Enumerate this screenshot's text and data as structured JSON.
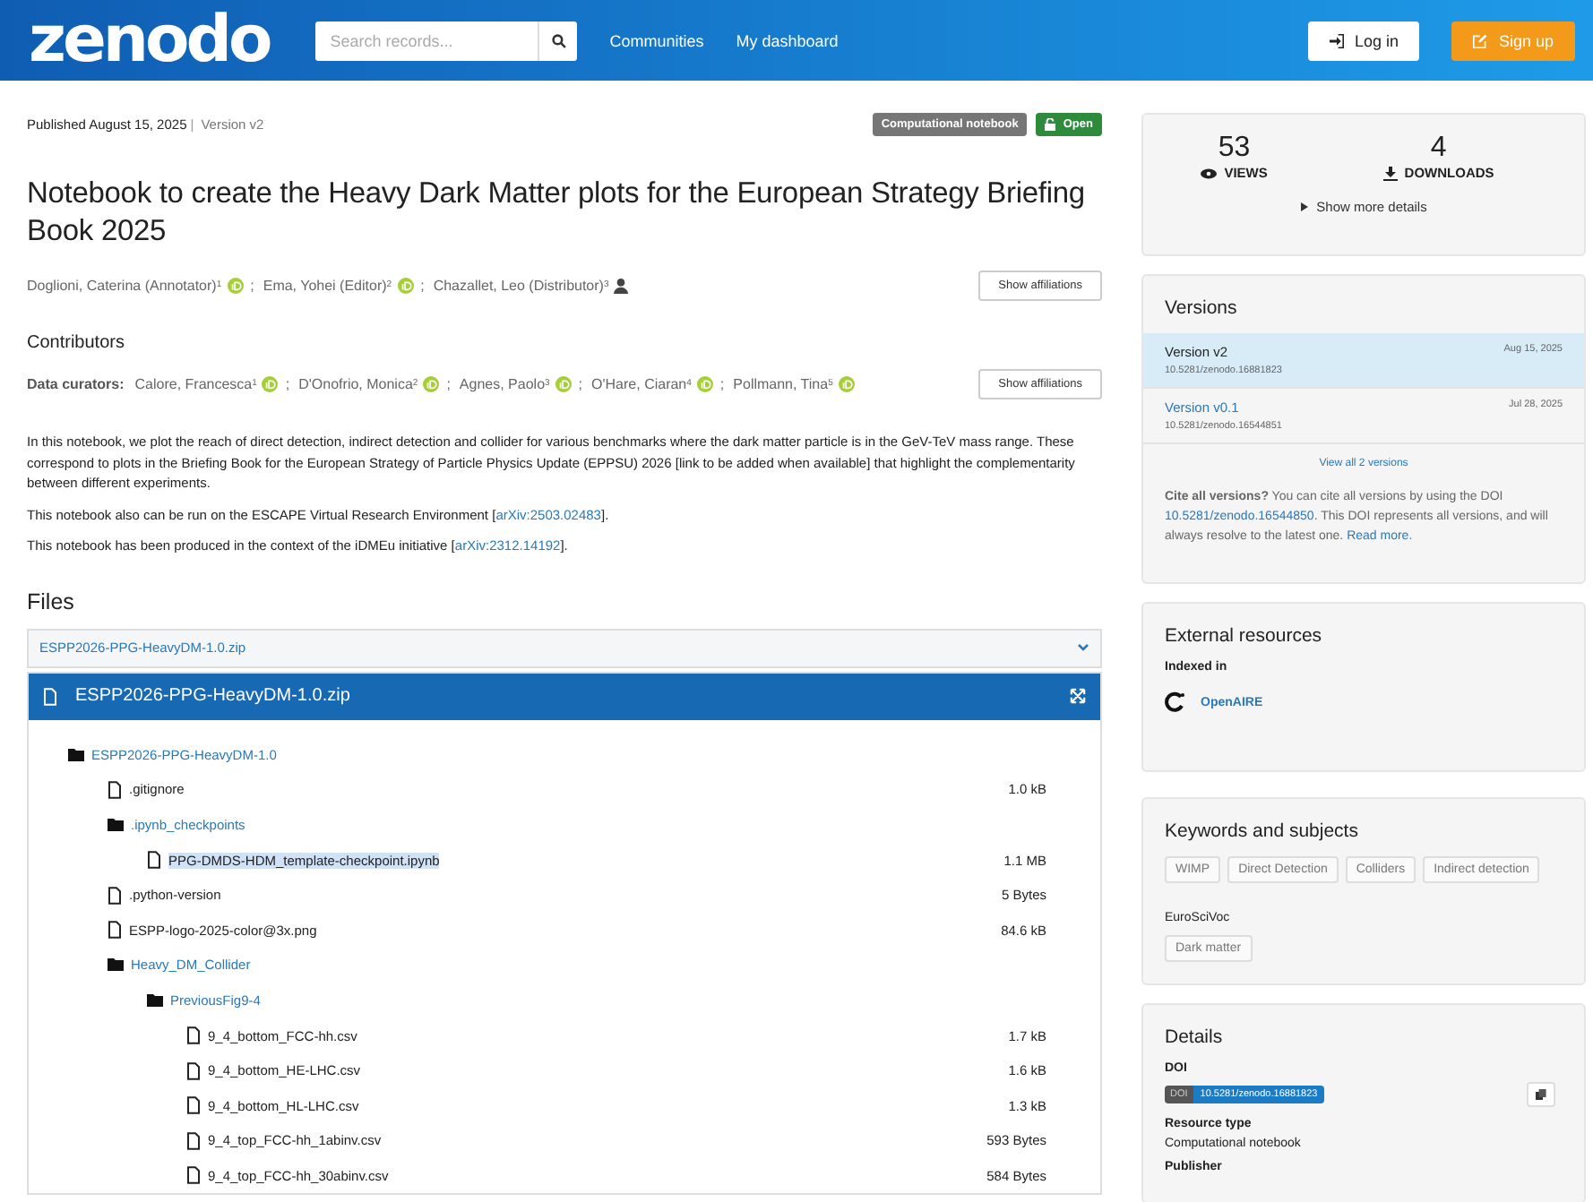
{
  "header": {
    "logo": "zenodo",
    "search": {
      "placeholder": "Search records..."
    },
    "nav": [
      "Communities",
      "My dashboard"
    ],
    "login": "Log in",
    "signup": "Sign up"
  },
  "record": {
    "published": "Published August 15, 2025",
    "divider": "|",
    "version": "Version v2",
    "separator": ";",
    "badges": [
      {
        "kind": "type",
        "label": "Computational notebook"
      },
      {
        "kind": "access",
        "label": "Open"
      }
    ],
    "title": "Notebook to create the Heavy Dark Matter plots for the European Strategy Briefing Book 2025",
    "creators": [
      {
        "name": "Doglioni, Caterina (Annotator)",
        "sup": "1",
        "kind": "orcid"
      },
      {
        "name": "Ema, Yohei (Editor)",
        "sup": "2",
        "kind": "orcid"
      },
      {
        "name": "Chazallet, Leo (Distributor)",
        "sup": "3",
        "kind": "person"
      }
    ],
    "show_affiliations": "Show affiliations",
    "contributors_heading": "Contributors",
    "curators_label": "Data curators:",
    "curators": [
      {
        "name": "Calore, Francesca",
        "sup": "1",
        "kind": "orcid"
      },
      {
        "name": "D'Onofrio, Monica",
        "sup": "2",
        "kind": "orcid"
      },
      {
        "name": "Agnes, Paolo",
        "sup": "3",
        "kind": "orcid"
      },
      {
        "name": "O'Hare, Ciaran",
        "sup": "4",
        "kind": "orcid"
      },
      {
        "name": "Pollmann, Tina",
        "sup": "5",
        "kind": "orcid"
      }
    ],
    "show_affiliations_2": "Show affiliations",
    "description": [
      {
        "text": "In this notebook, we plot the reach of direct detection, indirect detection and collider for various benchmarks where the dark matter particle is in the GeV-TeV mass range. These correspond to plots in the Briefing Book for the European Strategy of Particle Physics Update (EPPSU) 2026 [link to be added when available] that highlight the complementarity between different experiments."
      },
      {
        "text": "This notebook also can be run on the ESCAPE Virtual Research Environment [",
        "link": "arXiv:2503.02483",
        "after": "]."
      },
      {
        "text": "This notebook has been produced in the context of the iDMEu initiative [",
        "link": "arXiv:2312.14192",
        "after": "]."
      }
    ]
  },
  "files": {
    "heading": "Files",
    "accordion": "ESPP2026-PPG-HeavyDM-1.0.zip",
    "preview_title": "ESPP2026-PPG-HeavyDM-1.0.zip",
    "tree": [
      {
        "kind": "folder",
        "name": "ESPP2026-PPG-HeavyDM-1.0",
        "selected": false,
        "children": [
          {
            "kind": "file",
            "name": ".gitignore",
            "size": "1.0 kB",
            "selected": false
          },
          {
            "kind": "folder",
            "name": ".ipynb_checkpoints",
            "selected": false,
            "children": [
              {
                "kind": "file",
                "name": "PPG-DMDS-HDM_template-checkpoint.ipynb",
                "size": "1.1 MB",
                "selected": true
              }
            ]
          },
          {
            "kind": "file",
            "name": ".python-version",
            "size": "5 Bytes",
            "selected": false
          },
          {
            "kind": "file",
            "name": "ESPP-logo-2025-color@3x.png",
            "size": "84.6 kB",
            "selected": false
          },
          {
            "kind": "folder",
            "name": "Heavy_DM_Collider",
            "selected": false,
            "children": [
              {
                "kind": "folder",
                "name": "PreviousFig9-4",
                "selected": false,
                "children": [
                  {
                    "kind": "file",
                    "name": "9_4_bottom_FCC-hh.csv",
                    "size": "1.7 kB",
                    "selected": false
                  },
                  {
                    "kind": "file",
                    "name": "9_4_bottom_HE-LHC.csv",
                    "size": "1.6 kB",
                    "selected": false
                  },
                  {
                    "kind": "file",
                    "name": "9_4_bottom_HL-LHC.csv",
                    "size": "1.3 kB",
                    "selected": false
                  },
                  {
                    "kind": "file",
                    "name": "9_4_top_FCC-hh_1abinv.csv",
                    "size": "593 Bytes",
                    "selected": false
                  },
                  {
                    "kind": "file",
                    "name": "9_4_top_FCC-hh_30abinv.csv",
                    "size": "584 Bytes",
                    "selected": false
                  }
                ]
              }
            ]
          }
        ]
      }
    ]
  },
  "stats": {
    "views": "53",
    "views_label": "VIEWS",
    "downloads": "4",
    "downloads_label": "DOWNLOADS",
    "more": "Show more details"
  },
  "versions": {
    "heading": "Versions",
    "items": [
      {
        "label": "Version v2",
        "doi": "10.5281/zenodo.16881823",
        "date": "Aug 15, 2025",
        "selected": true
      },
      {
        "label": "Version v0.1",
        "doi": "10.5281/zenodo.16544851",
        "date": "Jul 28, 2025",
        "selected": false
      }
    ],
    "view_all": "View all 2 versions",
    "cite": "**Cite all versions?** You can cite all versions by using the DOI ",
    "cite_link": "10.5281/zenodo.16544850",
    "cite_after": ". This DOI represents all versions, and will always resolve to the latest one. ",
    "read_more": "Read more."
  },
  "external": {
    "heading": "External resources",
    "indexed": "Indexed in",
    "source": "OpenAIRE"
  },
  "keywords": {
    "heading": "Keywords and subjects",
    "tags": [
      "WIMP",
      "Direct Detection",
      "Colliders",
      "Indirect detection"
    ],
    "scheme": "EuroSciVoc",
    "scheme_tags": [
      "Dark matter"
    ]
  },
  "details": {
    "heading": "Details",
    "doi_label": "DOI",
    "doi_prefix": "DOI",
    "doi": "10.5281/zenodo.16881823",
    "resource_label": "Resource type",
    "resource": "Computational notebook",
    "publisher_label": "Publisher"
  }
}
